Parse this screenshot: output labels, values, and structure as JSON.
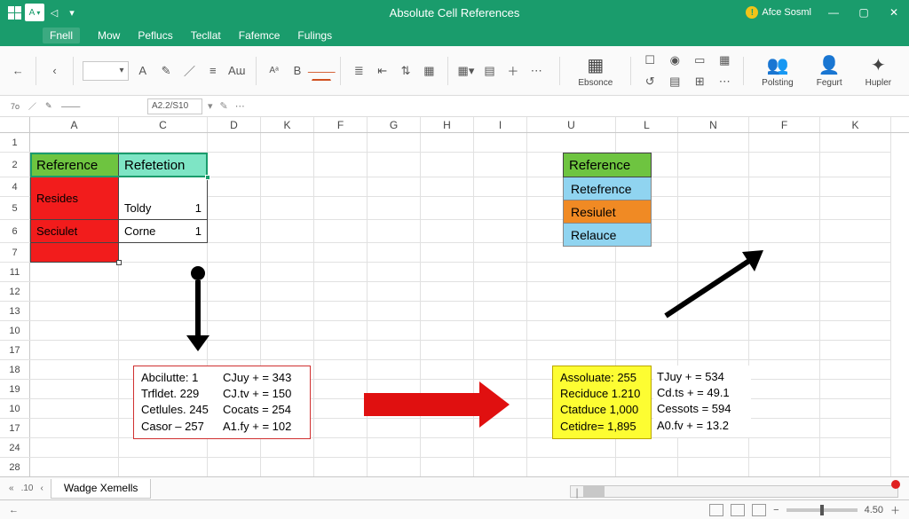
{
  "title": "Absolute Cell References",
  "user": "Afce Sosml",
  "qa_letter": "A",
  "menu": {
    "fnell": "Fnell",
    "mow": "Mow",
    "peflucs": "Peflucs",
    "tecllat": "Tecllat",
    "fafemce": "Fafemce",
    "fulings": "Fulings"
  },
  "ribbon_big": {
    "ebsonce": "Ebsonce",
    "polsting": "Polsting",
    "fegurt": "Fegurt",
    "hupler": "Hupler"
  },
  "subrow": {
    "left_label": "7o",
    "namebox": "A2.2/S10"
  },
  "columns": [
    "A",
    "C",
    "D",
    "K",
    "F",
    "G",
    "H",
    "I",
    "U",
    "L",
    "N",
    "F",
    "K"
  ],
  "rows": [
    "1",
    "2",
    "4",
    "5",
    "6",
    "7",
    "11",
    "12",
    "13",
    "10",
    "17",
    "18",
    "19",
    "10",
    "17",
    "24",
    "28"
  ],
  "tableA": {
    "h1": "Reference",
    "h2": "Refetetion",
    "r1a": "Resides",
    "r1b": "Toldy",
    "r1v": "1",
    "r2a": "Seciulet",
    "r2b": "Corne",
    "r2v": "1"
  },
  "tableU": {
    "r1": "Reference",
    "r2": "Retefrence",
    "r3": "Resiulet",
    "r4": "Relauce"
  },
  "boxL": {
    "l1a": "Abcilutte: 1",
    "l1b": "CJuy + = 343",
    "l2a": "Trfldet. 229",
    "l2b": "CJ.tv + = 150",
    "l3a": "Cetlules. 245",
    "l3b": "Cocats = 254",
    "l4a": "Casor – 257",
    "l4b": "A1.fy + = 102"
  },
  "boxR": {
    "l1a": "Assoluate: 255",
    "l1b": "TJuy + = 534",
    "l2a": "Reciduce 1.210",
    "l2b": "Cd.ts + = 49.1",
    "l3a": "Ctatduce 1,000",
    "l3b": "Cessots = 594",
    "l4a": "Cetidre= 1,895",
    "l4b": "A0.fv + = 13.2"
  },
  "sheet_tab": "Wadge Xemells",
  "rownav": ".10",
  "status_zoom": "4.50",
  "hscroll_left": "|"
}
